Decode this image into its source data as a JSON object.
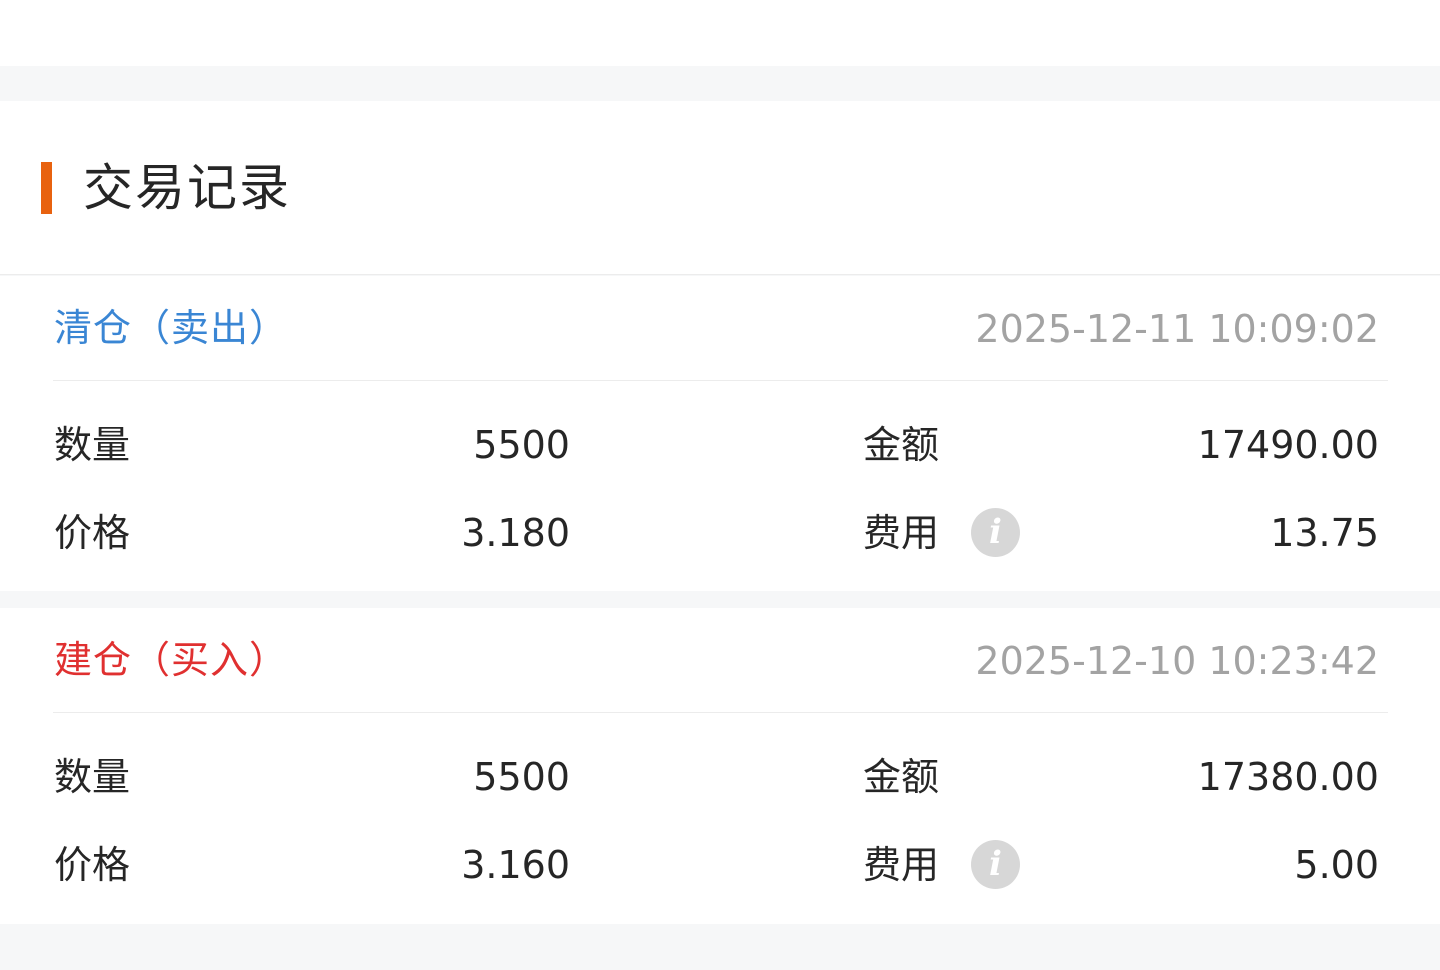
{
  "section": {
    "title": "交易记录",
    "accent_color": "#e8620f"
  },
  "trades": [
    {
      "type_label": "清仓（卖出）",
      "type_color": "#3a86d4",
      "time": "2025-12-11 10:09:02",
      "quantity_label": "数量",
      "quantity": "5500",
      "amount_label": "金额",
      "amount": "17490.00",
      "price_label": "价格",
      "price": "3.180",
      "fee_label": "费用",
      "fee": "13.75",
      "fee_info_icon": "info-icon"
    },
    {
      "type_label": "建仓（买入）",
      "type_color": "#e03030",
      "time": "2025-12-10 10:23:42",
      "quantity_label": "数量",
      "quantity": "5500",
      "amount_label": "金额",
      "amount": "17380.00",
      "price_label": "价格",
      "price": "3.160",
      "fee_label": "费用",
      "fee": "5.00",
      "fee_info_icon": "info-icon"
    }
  ]
}
